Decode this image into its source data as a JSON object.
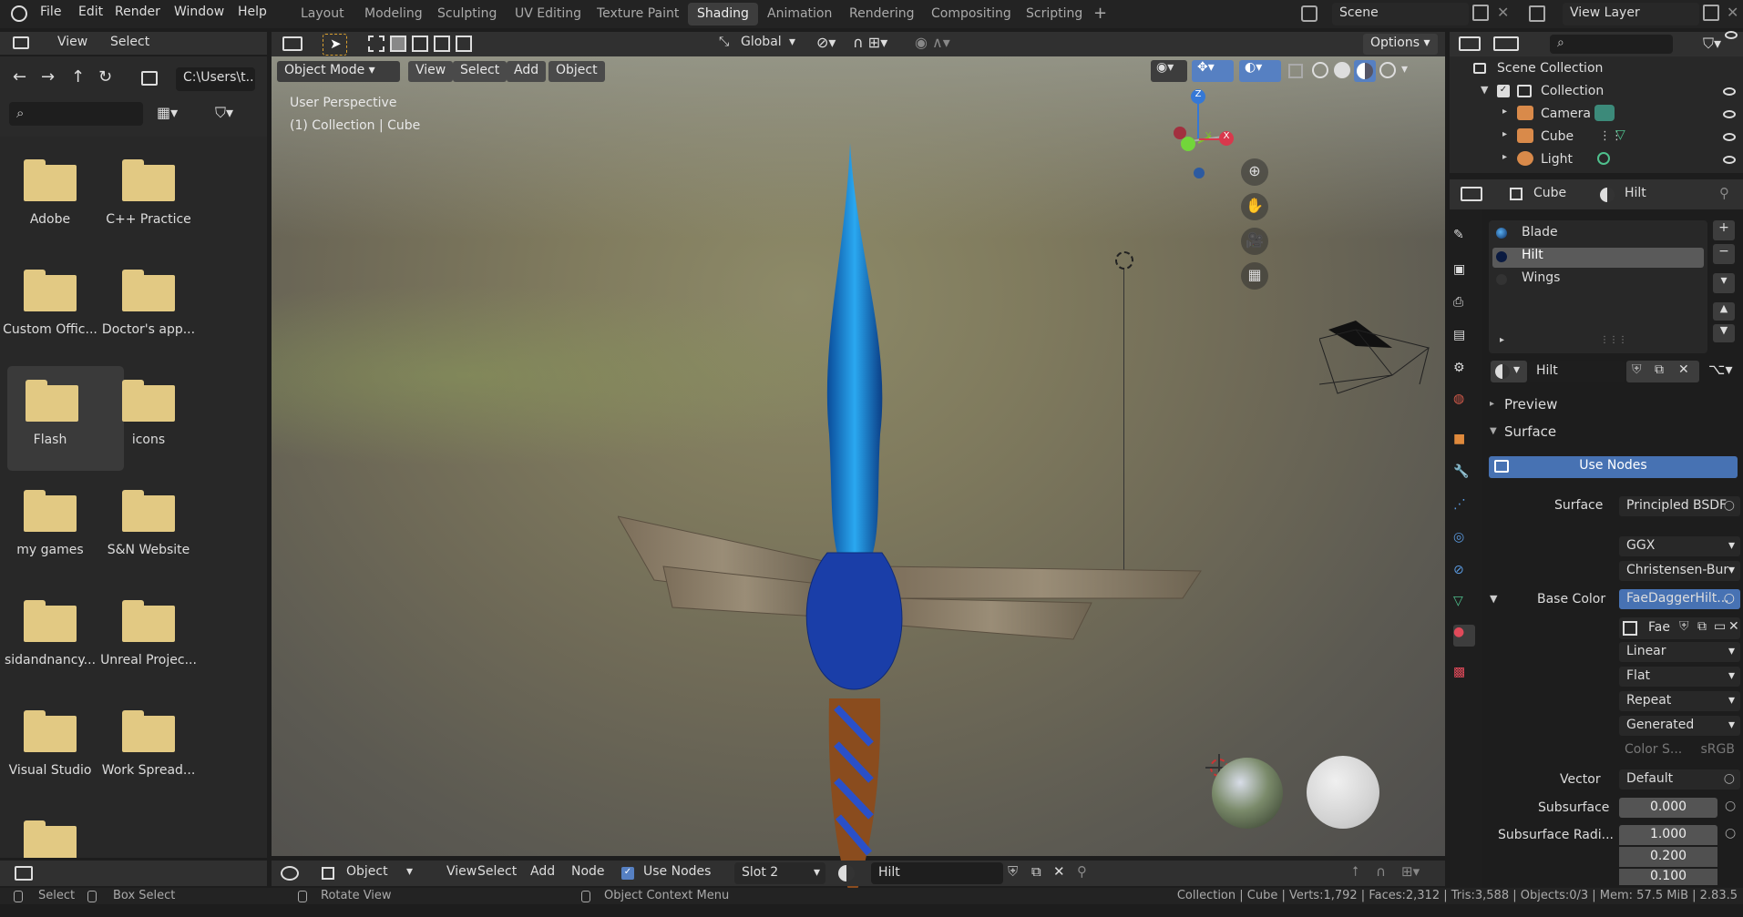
{
  "menubar": {
    "items": [
      "File",
      "Edit",
      "Render",
      "Window",
      "Help"
    ]
  },
  "workspaces": [
    "Layout",
    "Modeling",
    "Sculpting",
    "UV Editing",
    "Texture Paint",
    "Shading",
    "Animation",
    "Rendering",
    "Compositing",
    "Scripting"
  ],
  "active_workspace": "Shading",
  "scene": "Scene",
  "view_layer": "View Layer",
  "file_browser": {
    "header": {
      "view": "View",
      "select": "Select"
    },
    "path": "C:\\Users\\t...",
    "folders": [
      "Adobe",
      "C++ Practice",
      "Custom Offic...",
      "Doctor's app...",
      "Flash",
      "icons",
      "my games",
      "S&N Website",
      "sidandnancy...",
      "Unreal Projec...",
      "Visual Studio",
      "Work Spread..."
    ]
  },
  "viewport": {
    "header": {
      "transform": "Global",
      "options": "Options"
    },
    "mode": "Object Mode",
    "menus": [
      "View",
      "Select",
      "Add",
      "Object"
    ],
    "overlay_line1": "User Perspective",
    "overlay_line2": "(1) Collection | Cube",
    "gizmo": {
      "z": "Z",
      "y": "Y",
      "x": "X"
    }
  },
  "outliner": {
    "title": "Scene Collection",
    "collection": "Collection",
    "items": [
      "Camera",
      "Cube",
      "Light"
    ]
  },
  "properties": {
    "object": "Cube",
    "material": "Hilt",
    "slots": [
      "Blade",
      "Hilt",
      "Wings"
    ],
    "material_name": "Hilt",
    "preview": "Preview",
    "surface_section": "Surface",
    "use_nodes": "Use Nodes",
    "rows": {
      "surface_label": "Surface",
      "surface_value": "Principled BSDF",
      "distribution": "GGX",
      "subsurface_method": "Christensen-Bur",
      "base_color_label": "Base Color",
      "base_color_value": "FaeDaggerHilt...",
      "image_name": "Fae",
      "interp": "Linear",
      "proj": "Flat",
      "ext": "Repeat",
      "source": "Generated",
      "color_space_label": "Color S...",
      "color_space_value": "sRGB",
      "vector_label": "Vector",
      "vector_value": "Default",
      "subsurface_label": "Subsurface",
      "subsurface_value": "0.000",
      "subsurface_radius_label": "Subsurface Radi...",
      "sr1": "1.000",
      "sr2": "0.200",
      "sr3": "0.100"
    }
  },
  "node_header": {
    "object": "Object",
    "menus": [
      "View",
      "Select",
      "Add",
      "Node"
    ],
    "use_nodes": "Use Nodes",
    "slot": "Slot 2",
    "material": "Hilt"
  },
  "statusbar": {
    "select": "Select",
    "box_select": "Box Select",
    "rotate": "Rotate View",
    "context": "Object Context Menu",
    "stats": "Collection | Cube | Verts:1,792 | Faces:2,312 | Tris:3,588 | Objects:0/3 | Mem: 57.5 MiB | 2.83.5"
  }
}
